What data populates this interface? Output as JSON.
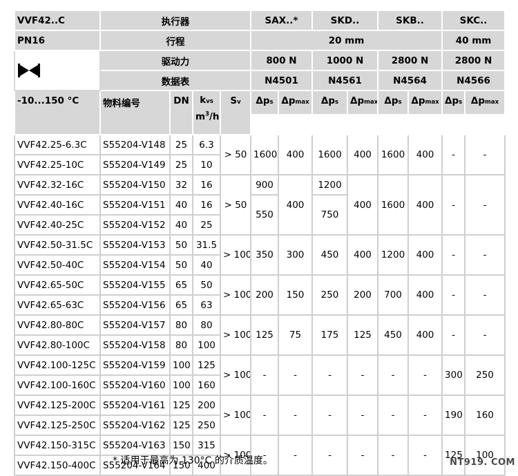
{
  "header": {
    "model_family": "VVF42..C",
    "actuator_label": "执行器",
    "actuators": [
      "SAX..*",
      "SKD..",
      "SKB..",
      "SKC.."
    ],
    "pressure_class": "PN16",
    "stroke_label": "行程",
    "stroke_small": "20 mm",
    "stroke_large": "40 mm",
    "force_label": "驱动力",
    "forces": [
      "800 N",
      "1000 N",
      "2800 N",
      "2800 N"
    ],
    "datasheet_label": "数据表",
    "datasheets": [
      "N4501",
      "N4561",
      "N4564",
      "N4566"
    ],
    "valve_icon": "two-way-valve-icon"
  },
  "columns": {
    "temperature": "-10...150 °C",
    "part_number": "物料编号",
    "dn": "DN",
    "kvs_k": "k",
    "kvs_sub": "vs",
    "kvs_unit": "m",
    "kvs_unit_sup": "3",
    "kvs_unit_tail": "/h",
    "sv_s": "S",
    "sv_sub": "v",
    "dp": "Δp",
    "dp_s_sub": "s",
    "dp_max_text": "Δp",
    "dp_max_sub": "max"
  },
  "rows": [
    {
      "type": "VVF42.25-6.3C",
      "part": "S55204-V148",
      "dn": "25",
      "kvs": "6.3"
    },
    {
      "type": "VVF42.25-10C",
      "part": "S55204-V149",
      "dn": "25",
      "kvs": "10"
    },
    {
      "type": "VVF42.32-16C",
      "part": "S55204-V150",
      "dn": "32",
      "kvs": "16"
    },
    {
      "type": "VVF42.40-16C",
      "part": "S55204-V151",
      "dn": "40",
      "kvs": "16"
    },
    {
      "type": "VVF42.40-25C",
      "part": "S55204-V152",
      "dn": "40",
      "kvs": "25"
    },
    {
      "type": "VVF42.50-31.5C",
      "part": "S55204-V153",
      "dn": "50",
      "kvs": "31.5"
    },
    {
      "type": "VVF42.50-40C",
      "part": "S55204-V154",
      "dn": "50",
      "kvs": "40"
    },
    {
      "type": "VVF42.65-50C",
      "part": "S55204-V155",
      "dn": "65",
      "kvs": "50"
    },
    {
      "type": "VVF42.65-63C",
      "part": "S55204-V156",
      "dn": "65",
      "kvs": "63"
    },
    {
      "type": "VVF42.80-80C",
      "part": "S55204-V157",
      "dn": "80",
      "kvs": "80"
    },
    {
      "type": "VVF42.80-100C",
      "part": "S55204-V158",
      "dn": "80",
      "kvs": "100"
    },
    {
      "type": "VVF42.100-125C",
      "part": "S55204-V159",
      "dn": "100",
      "kvs": "125"
    },
    {
      "type": "VVF42.100-160C",
      "part": "S55204-V160",
      "dn": "100",
      "kvs": "160"
    },
    {
      "type": "VVF42.125-200C",
      "part": "S55204-V161",
      "dn": "125",
      "kvs": "200"
    },
    {
      "type": "VVF42.125-250C",
      "part": "S55204-V162",
      "dn": "125",
      "kvs": "250"
    },
    {
      "type": "VVF42.150-315C",
      "part": "S55204-V163",
      "dn": "150",
      "kvs": "315"
    },
    {
      "type": "VVF42.150-400C",
      "part": "S55204-V164",
      "dn": "150",
      "kvs": "400"
    }
  ],
  "groups": {
    "g1": {
      "sv": "> 50",
      "sax_s": "1600",
      "sax_max": "400",
      "skd_s": "1600",
      "skd_max": "400",
      "skb_s": "1600",
      "skb_max": "400",
      "skc_s": "-",
      "skc_max": "-"
    },
    "g2": {
      "sv": "> 50",
      "sax_s_a": "900",
      "sax_s_b": "550",
      "sax_max": "400",
      "skd_s_a": "1200",
      "skd_s_b": "750",
      "skd_max": "400",
      "skb_s": "1600",
      "skb_max": "400",
      "skc_s": "-",
      "skc_max": "-"
    },
    "g3": {
      "sv": "> 100",
      "sax_s": "350",
      "sax_max": "300",
      "skd_s": "450",
      "skd_max": "400",
      "skb_s": "1200",
      "skb_max": "400",
      "skc_s": "-",
      "skc_max": "-"
    },
    "g4": {
      "sv": "> 100",
      "sax_s": "200",
      "sax_max": "150",
      "skd_s": "250",
      "skd_max": "200",
      "skb_s": "700",
      "skb_max": "400",
      "skc_s": "-",
      "skc_max": "-"
    },
    "g5": {
      "sv": "> 100",
      "sax_s": "125",
      "sax_max": "75",
      "skd_s": "175",
      "skd_max": "125",
      "skb_s": "450",
      "skb_max": "400",
      "skc_s": "-",
      "skc_max": "-"
    },
    "g6": {
      "sv": "> 100",
      "sax_s": "-",
      "sax_max": "-",
      "skd_s": "-",
      "skd_max": "-",
      "skb_s": "-",
      "skb_max": "-",
      "skc_s": "300",
      "skc_max": "250"
    },
    "g7": {
      "sv": "> 100",
      "sax_s": "-",
      "sax_max": "-",
      "skd_s": "-",
      "skd_max": "-",
      "skb_s": "-",
      "skb_max": "-",
      "skc_s": "190",
      "skc_max": "160"
    },
    "g8": {
      "sv": "> 100",
      "sax_s": "-",
      "sax_max": "-",
      "skd_s": "-",
      "skd_max": "-",
      "skb_s": "-",
      "skb_max": "-",
      "skc_s": "125",
      "skc_max": "100"
    }
  },
  "footnote": "* 适用于最高为 130°C 的介质温度。",
  "watermark": "NT919. COM"
}
